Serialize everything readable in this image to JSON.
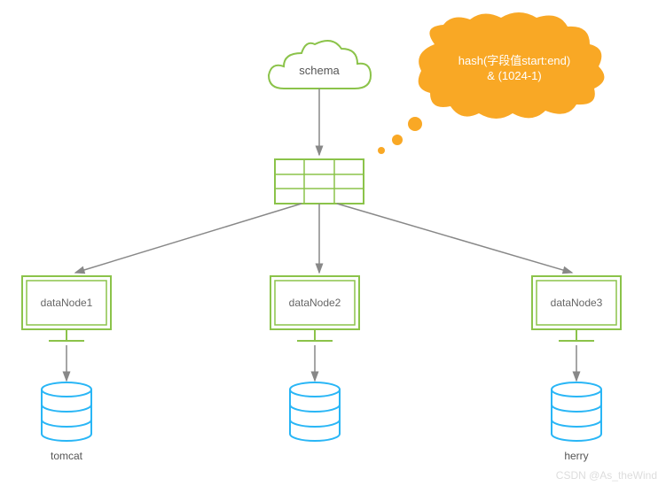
{
  "cloud_label": "schema",
  "bubble_line1": "hash(字段值start:end)",
  "bubble_line2": "& (1024-1)",
  "nodes": [
    {
      "name": "dataNode1",
      "bottom_label": "tomcat"
    },
    {
      "name": "dataNode2",
      "bottom_label": ""
    },
    {
      "name": "dataNode3",
      "bottom_label": "herry"
    }
  ],
  "watermark": "CSDN @As_theWind",
  "colors": {
    "green": "#8BC34A",
    "blue": "#29B6F6",
    "orange": "#F9A825",
    "gray": "#888"
  }
}
